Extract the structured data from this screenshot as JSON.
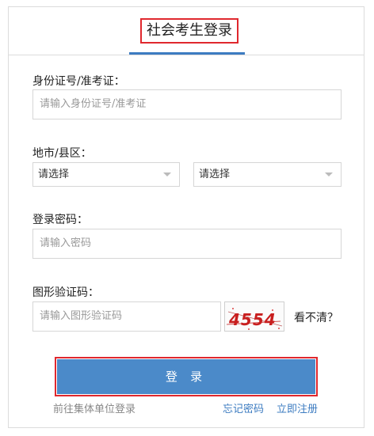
{
  "tab": {
    "title": "社会考生登录"
  },
  "id_field": {
    "label": "身份证号/准考证：",
    "placeholder": "请输入身份证号/准考证"
  },
  "region": {
    "label": "地市/县区：",
    "city_select": "请选择",
    "district_select": "请选择"
  },
  "password": {
    "label": "登录密码：",
    "placeholder": "请输入密码"
  },
  "captcha": {
    "label": "图形验证码：",
    "placeholder": "请输入图形验证码",
    "image_text": "4554",
    "refresh_text": "看不清？"
  },
  "login_button": "登 录",
  "links": {
    "group_login": "前往集体单位登录",
    "forgot_password": "忘记密码",
    "register": "立即注册"
  },
  "colors": {
    "accent": "#4b8ac9",
    "highlight": "#e0282e",
    "link": "#3d7cc1"
  }
}
